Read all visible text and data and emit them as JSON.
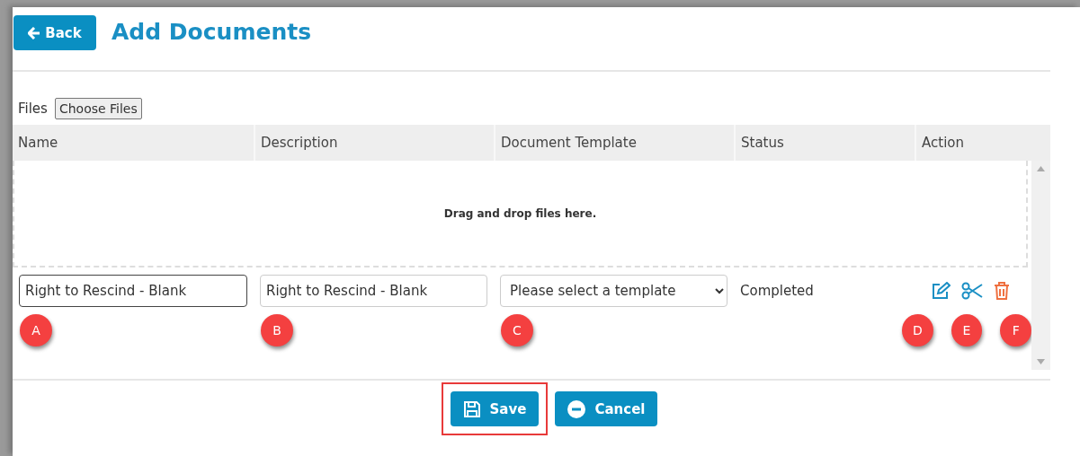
{
  "header": {
    "back_button": "Back",
    "title": "Add Documents"
  },
  "files": {
    "label": "Files",
    "button": "Choose Files"
  },
  "table": {
    "columns": [
      "Name",
      "Description",
      "Document Template",
      "Status",
      "Action"
    ],
    "dropzone": "Drag and drop files here.",
    "rows": [
      {
        "name": {
          "value": "Right to Rescind - Blank",
          "focused": true,
          "marker": "A"
        },
        "description": {
          "value": "Right to Rescind - Blank",
          "focused": false,
          "marker": "B"
        },
        "template": {
          "placeholder": "Please select a template",
          "marker": "C"
        },
        "status": "Completed",
        "actions": [
          {
            "kind": "edit",
            "marker": "D"
          },
          {
            "kind": "cut",
            "marker": "E"
          },
          {
            "kind": "delete",
            "marker": "F"
          }
        ]
      }
    ]
  },
  "buttons": [
    {
      "kind": "save",
      "label": "Save",
      "highlighted": true
    },
    {
      "kind": "cancel",
      "label": "Cancel",
      "highlighted": false
    }
  ]
}
